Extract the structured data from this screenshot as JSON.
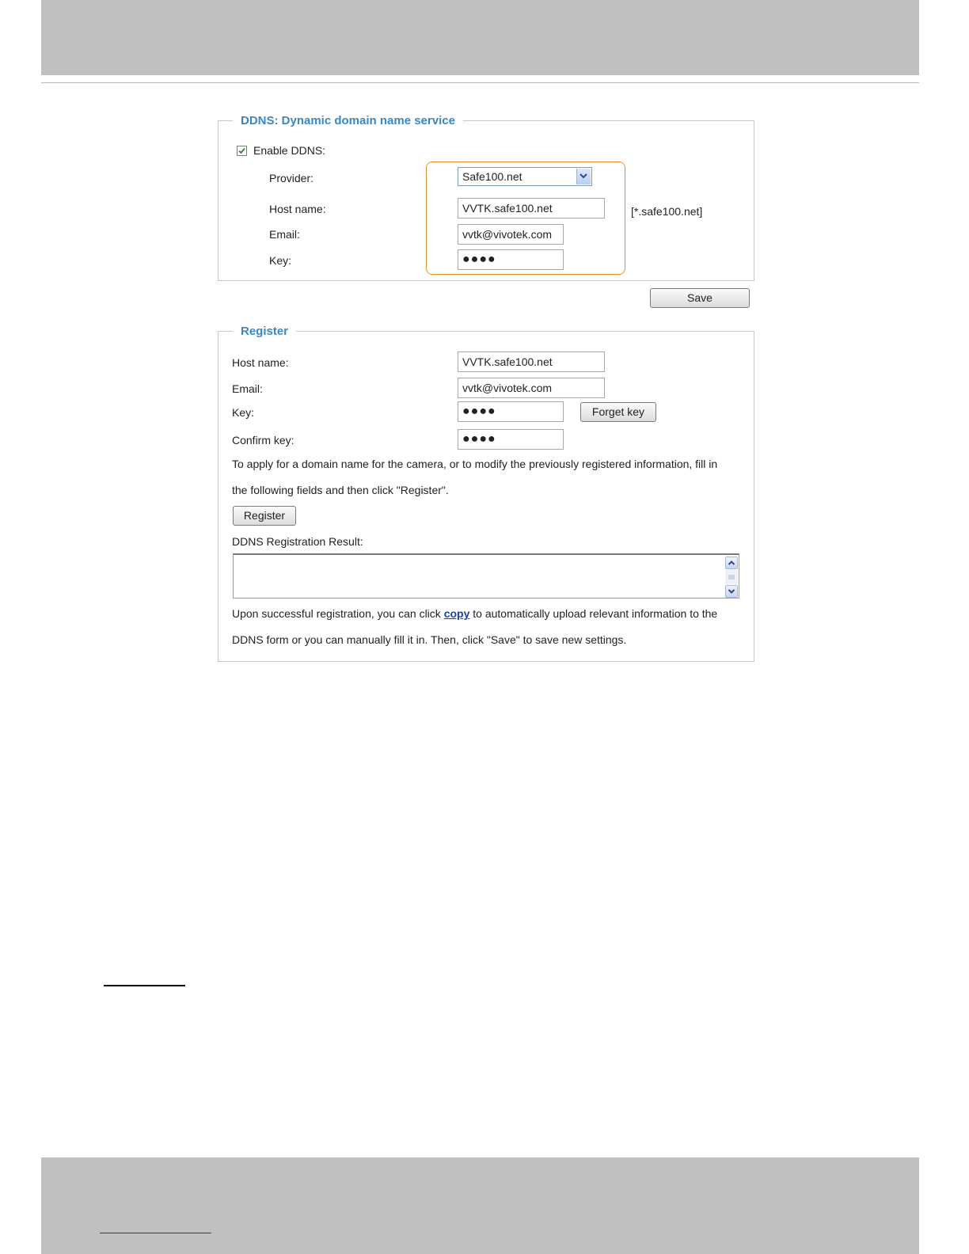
{
  "ddns": {
    "legend": "DDNS: Dynamic domain name service",
    "enable_label": "Enable DDNS:",
    "enable_checked": true,
    "provider_label": "Provider:",
    "provider_value": "Safe100.net",
    "hostname_label": "Host name:",
    "hostname_value": "VVTK.safe100.net",
    "hostname_suffix": "[*.safe100.net]",
    "email_label": "Email:",
    "email_value": "vvtk@vivotek.com",
    "key_label": "Key:",
    "key_value": "●●●●",
    "save_label": "Save"
  },
  "register": {
    "legend": "Register",
    "hostname_label": "Host name:",
    "hostname_value": "VVTK.safe100.net",
    "email_label": "Email:",
    "email_value": "vvtk@vivotek.com",
    "key_label": "Key:",
    "key_value": "●●●●",
    "forget_key_label": "Forget key",
    "confirm_key_label": "Confirm key:",
    "confirm_key_value": "●●●●",
    "instruction_line1": "To apply for a domain name for the camera, or to modify the previously registered information, fill in",
    "instruction_line2": "the following fields and then click \"Register\".",
    "register_label": "Register",
    "result_label": "DDNS Registration Result:",
    "result_value": "",
    "note_before": "Upon successful registration, you can click ",
    "note_link": "copy",
    "note_after": " to automatically upload relevant information to the",
    "note_line2": "DDNS form or you can manually fill it in. Then, click \"Save\" to save new settings."
  },
  "colors": {
    "legend": "#3a87c6",
    "highlight": "#e8912a",
    "band": "#c0c0c0",
    "link": "#1a3fb0"
  },
  "icons": [
    "checkmark-icon",
    "chevron-down-icon",
    "scroll-up-icon",
    "scroll-down-icon"
  ]
}
